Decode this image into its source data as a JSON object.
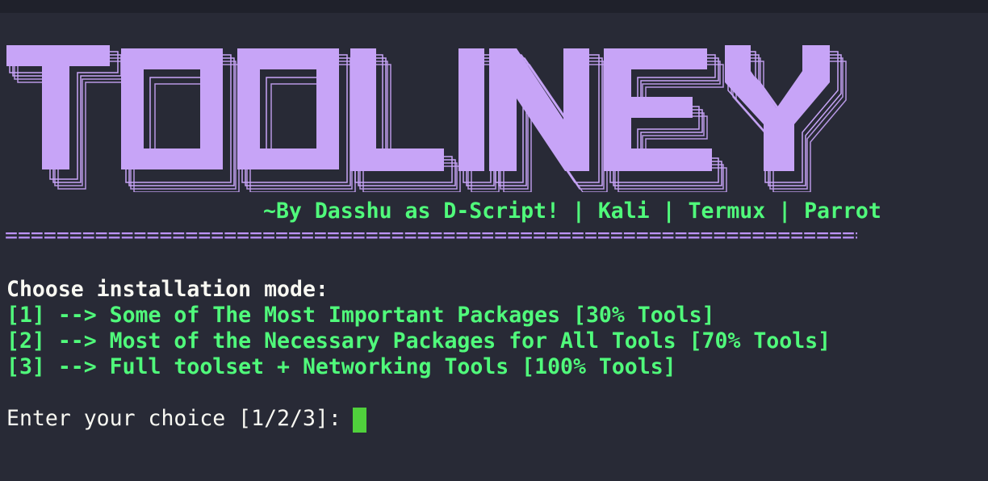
{
  "banner": {
    "logo_text": "TOOLINEY",
    "color": "#c7a4f7"
  },
  "byline": "~By Dasshu as D-Script! | Kali | Termux | Parrot",
  "separator": "==========================================================================",
  "menu": {
    "title": "Choose installation mode:",
    "options": [
      "[1] --> Some of The Most Important Packages [30% Tools]",
      "[2] --> Most of the Necessary Packages for All Tools [70% Tools]",
      "[3] --> Full toolset + Networking Tools [100% Tools]"
    ]
  },
  "input": {
    "prompt": "Enter your choice [1/2/3]: ",
    "value": ""
  },
  "colors": {
    "background": "#282a36",
    "accent_green": "#50fa7b",
    "accent_purple": "#bd93f9",
    "text": "#f8f8f2",
    "cursor": "#50d03c"
  }
}
